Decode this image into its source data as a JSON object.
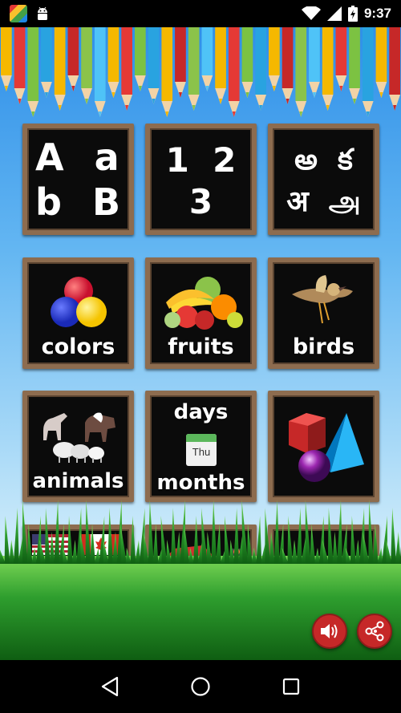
{
  "status_bar": {
    "time": "9:37",
    "icons": [
      "app-notification-icon",
      "android-debug-icon",
      "wifi-icon",
      "cell-signal-icon",
      "battery-icon"
    ]
  },
  "tiles": {
    "alphabet": {
      "lines": [
        "A  a",
        "b  B"
      ]
    },
    "numbers": {
      "lines": [
        "1  2",
        "3"
      ]
    },
    "scripts": {
      "lines": [
        "అ  క",
        "अ  அ"
      ]
    },
    "colors": {
      "label": "colors"
    },
    "fruits": {
      "label": "fruits"
    },
    "birds": {
      "label": "birds"
    },
    "animals": {
      "label": "animals"
    },
    "days_months": {
      "top": "days",
      "calendar_text": "Thu",
      "bottom": "months"
    },
    "shapes": {
      "label": ""
    },
    "flags": {
      "label": ""
    },
    "vehicles": {
      "label": ""
    },
    "misc": {
      "label": ""
    }
  },
  "fabs": {
    "sound": {
      "icon": "speaker-icon"
    },
    "share": {
      "icon": "share-icon"
    }
  },
  "nav": {
    "back": "back-icon",
    "home": "home-icon",
    "recents": "recents-icon"
  },
  "colors": {
    "frame": "#8d6c4f",
    "board": "#0b0b0b",
    "fab": "#c62828",
    "sky_top": "#2f8fe8",
    "grass": "#2e9e2e"
  }
}
